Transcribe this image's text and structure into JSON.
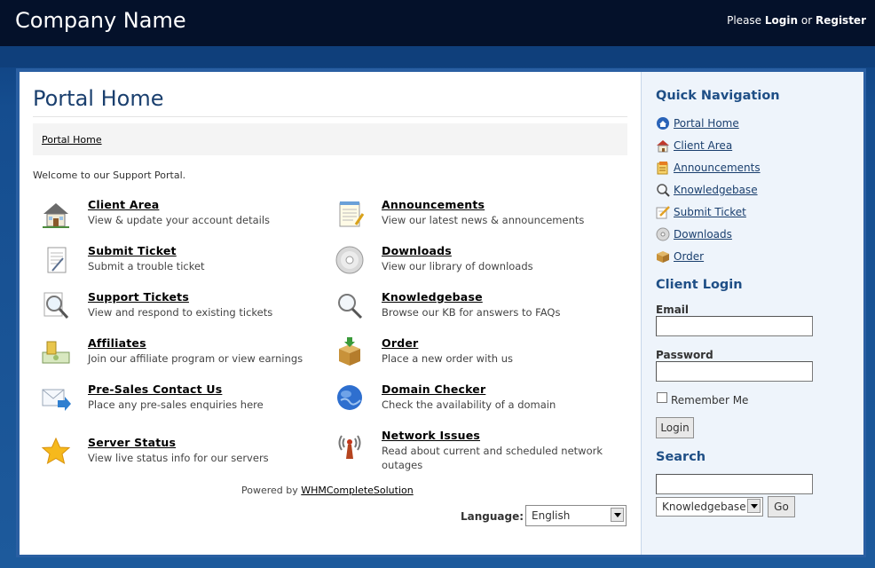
{
  "header": {
    "company": "Company Name",
    "please": "Please",
    "login": "Login",
    "or": "or",
    "register": "Register"
  },
  "page": {
    "title": "Portal Home",
    "breadcrumb": "Portal Home",
    "welcome": "Welcome to our Support Portal."
  },
  "features": [
    {
      "title": "Client Area",
      "desc": "View & update your account details",
      "icon": "house-icon"
    },
    {
      "title": "Announcements",
      "desc": "View our latest news & announcements",
      "icon": "notepad-icon"
    },
    {
      "title": "Submit Ticket",
      "desc": "Submit a trouble ticket",
      "icon": "document-pen-icon"
    },
    {
      "title": "Downloads",
      "desc": "View our library of downloads",
      "icon": "disc-icon"
    },
    {
      "title": "Support Tickets",
      "desc": "View and respond to existing tickets",
      "icon": "magnifier-document-icon"
    },
    {
      "title": "Knowledgebase",
      "desc": "Browse our KB for answers to FAQs",
      "icon": "magnifier-icon"
    },
    {
      "title": "Affiliates",
      "desc": "Join our affiliate program or view earnings",
      "icon": "money-icon"
    },
    {
      "title": "Order",
      "desc": "Place a new order with us",
      "icon": "box-icon"
    },
    {
      "title": "Pre-Sales Contact Us",
      "desc": "Place any pre-sales enquiries here",
      "icon": "email-arrow-icon"
    },
    {
      "title": "Domain Checker",
      "desc": "Check the availability of a domain",
      "icon": "globe-icon"
    },
    {
      "title": "Server Status",
      "desc": "View live status info for our servers",
      "icon": "star-icon"
    },
    {
      "title": "Network Issues",
      "desc": "Read about current and scheduled network outages",
      "icon": "antenna-icon"
    }
  ],
  "footer": {
    "powered_prefix": "Powered by",
    "powered_link": "WHMCompleteSolution",
    "language_label": "Language:",
    "language_value": "English"
  },
  "sidebar": {
    "quick_nav_title": "Quick Navigation",
    "nav": [
      {
        "label": "Portal Home",
        "icon": "home-circle-icon"
      },
      {
        "label": "Client Area",
        "icon": "house-icon"
      },
      {
        "label": "Announcements",
        "icon": "announcement-icon"
      },
      {
        "label": "Knowledgebase",
        "icon": "magnifier-icon"
      },
      {
        "label": "Submit Ticket",
        "icon": "pencil-paper-icon"
      },
      {
        "label": "Downloads",
        "icon": "disc-icon"
      },
      {
        "label": "Order",
        "icon": "box-icon"
      }
    ],
    "client_login_title": "Client Login",
    "email_label": "Email",
    "email_value": "",
    "password_label": "Password",
    "password_value": "",
    "remember_label": "Remember Me",
    "login_button": "Login",
    "search_title": "Search",
    "search_value": "",
    "search_scope": "Knowledgebase",
    "go_button": "Go"
  },
  "colors": {
    "topbar": "#04112a",
    "background": "#1d5a9c",
    "heading": "#1a3f6e",
    "sidebar_bg": "#eef4fb"
  }
}
